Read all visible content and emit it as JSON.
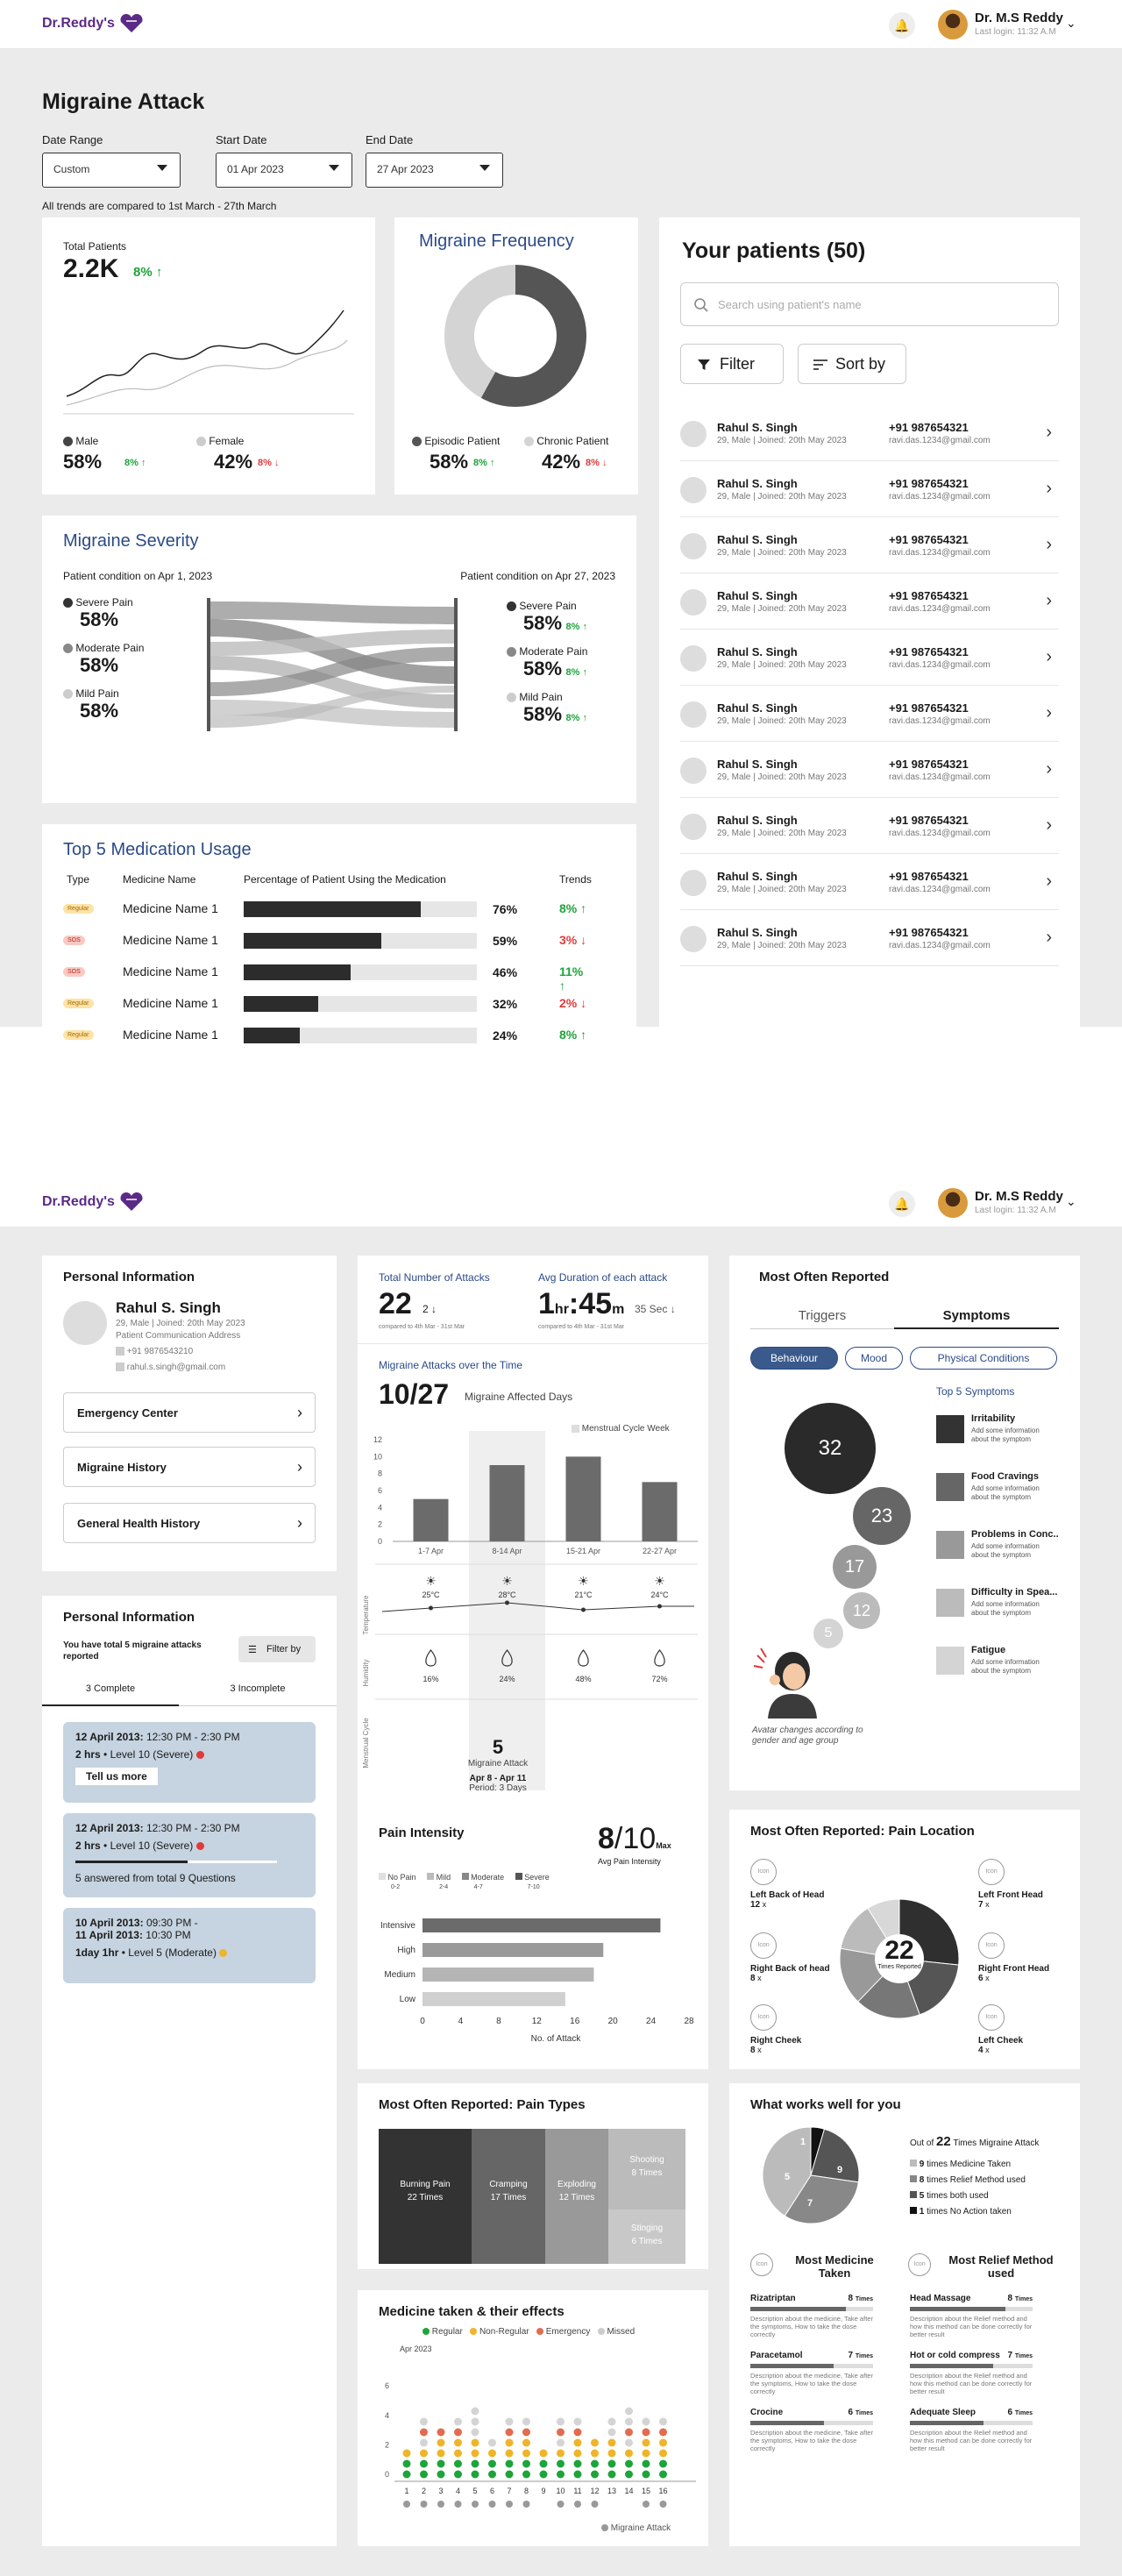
{
  "brand": {
    "name": "Dr.Reddy's"
  },
  "user": {
    "name": "Dr. M.S Reddy",
    "last_login": "Last login: 11:32 A.M"
  },
  "page": {
    "title": "Migraine Attack",
    "trend_note": "All trends are compared to 1st March - 27th March"
  },
  "filters": {
    "date_range_label": "Date Range",
    "date_range_value": "Custom",
    "start_label": "Start Date",
    "start_value": "01 Apr 2023",
    "end_label": "End Date",
    "end_value": "27 Apr 2023"
  },
  "total_patients": {
    "label": "Total Patients",
    "value": "2.2K",
    "trend": "8%",
    "male_label": "Male",
    "male_value": "58%",
    "male_trend": "8%",
    "female_label": "Female",
    "female_value": "42%",
    "female_trend": "8%"
  },
  "frequency": {
    "title": "Migraine Frequency",
    "episodic_label": "Episodic Patient",
    "episodic_value": "58%",
    "episodic_trend": "8%",
    "chronic_label": "Chronic Patient",
    "chronic_value": "42%",
    "chronic_trend": "8%"
  },
  "severity": {
    "title": "Migraine Severity",
    "left_caption": "Patient condition on Apr 1, 2023",
    "right_caption": "Patient condition on Apr 27, 2023",
    "left": [
      {
        "label": "Severe Pain",
        "value": "58%"
      },
      {
        "label": "Moderate Pain",
        "value": "58%"
      },
      {
        "label": "Mild Pain",
        "value": "58%"
      }
    ],
    "right": [
      {
        "label": "Severe Pain",
        "value": "58%",
        "trend": "8%"
      },
      {
        "label": "Moderate Pain",
        "value": "58%",
        "trend": "8%"
      },
      {
        "label": "Mild Pain",
        "value": "58%",
        "trend": "8%"
      }
    ]
  },
  "medication": {
    "title": "Top 5 Medication Usage",
    "col_type": "Type",
    "col_name": "Medicine Name",
    "col_pct": "Percentage of Patient Using the Medication",
    "col_trend": "Trends",
    "rows": [
      {
        "type": "Regular",
        "name": "Medicine Name 1",
        "pct": "76%",
        "pct_value": 76,
        "trend": "8%",
        "dir": "up"
      },
      {
        "type": "SOS",
        "name": "Medicine Name 1",
        "pct": "59%",
        "pct_value": 59,
        "trend": "3%",
        "dir": "down"
      },
      {
        "type": "SOS",
        "name": "Medicine Name 1",
        "pct": "46%",
        "pct_value": 46,
        "trend": "11%",
        "dir": "up"
      },
      {
        "type": "Regular",
        "name": "Medicine Name 1",
        "pct": "32%",
        "pct_value": 32,
        "trend": "2%",
        "dir": "down"
      },
      {
        "type": "Regular",
        "name": "Medicine Name 1",
        "pct": "24%",
        "pct_value": 24,
        "trend": "8%",
        "dir": "up"
      }
    ]
  },
  "patients": {
    "title": "Your patients (50)",
    "search_placeholder": "Search using patient's name",
    "filter_label": "Filter",
    "sort_label": "Sort by",
    "items": [
      {
        "name": "Rahul S. Singh",
        "meta": "29, Male | Joined: 20th May 2023",
        "phone": "+91 987654321",
        "email": "ravi.das.1234@gmail.com"
      },
      {
        "name": "Rahul S. Singh",
        "meta": "29, Male | Joined: 20th May 2023",
        "phone": "+91 987654321",
        "email": "ravi.das.1234@gmail.com"
      },
      {
        "name": "Rahul S. Singh",
        "meta": "29, Male | Joined: 20th May 2023",
        "phone": "+91 987654321",
        "email": "ravi.das.1234@gmail.com"
      },
      {
        "name": "Rahul S. Singh",
        "meta": "29, Male | Joined: 20th May 2023",
        "phone": "+91 987654321",
        "email": "ravi.das.1234@gmail.com"
      },
      {
        "name": "Rahul S. Singh",
        "meta": "29, Male | Joined: 20th May 2023",
        "phone": "+91 987654321",
        "email": "ravi.das.1234@gmail.com"
      },
      {
        "name": "Rahul S. Singh",
        "meta": "29, Male | Joined: 20th May 2023",
        "phone": "+91 987654321",
        "email": "ravi.das.1234@gmail.com"
      },
      {
        "name": "Rahul S. Singh",
        "meta": "29, Male | Joined: 20th May 2023",
        "phone": "+91 987654321",
        "email": "ravi.das.1234@gmail.com"
      },
      {
        "name": "Rahul S. Singh",
        "meta": "29, Male | Joined: 20th May 2023",
        "phone": "+91 987654321",
        "email": "ravi.das.1234@gmail.com"
      },
      {
        "name": "Rahul S. Singh",
        "meta": "29, Male | Joined: 20th May 2023",
        "phone": "+91 987654321",
        "email": "ravi.das.1234@gmail.com"
      },
      {
        "name": "Rahul S. Singh",
        "meta": "29, Male | Joined: 20th May 2023",
        "phone": "+91 987654321",
        "email": "ravi.das.1234@gmail.com"
      }
    ]
  },
  "personal": {
    "title": "Personal Information",
    "name": "Rahul S. Singh",
    "meta": "29, Male | Joined: 20th May 2023",
    "address": "Patient Communication Address",
    "phone": "+91 9876543210",
    "email": "rahul.s.singh@gmail.com",
    "links": [
      "Emergency Center",
      "Migraine History",
      "General Health History"
    ]
  },
  "attacks": {
    "title": "Personal Information",
    "summary": "You have total 5 migraine attacks reported",
    "filter_label": "Filter by",
    "tab_complete": "3 Complete",
    "tab_incomplete": "3 Incomplete",
    "items": [
      {
        "date": "12 April 2013:",
        "time": "12:30 PM - 2:30 PM",
        "dur": "2 hrs",
        "level": "Level 10 (Severe)",
        "action": "Tell us more"
      },
      {
        "date": "12 April 2013:",
        "time": "12:30 PM - 2:30 PM",
        "dur": "2 hrs",
        "level": "Level 10 (Severe)",
        "note": "5 answered from total 9 Questions"
      },
      {
        "date": "10 April 2013:",
        "time": "09:30 PM -",
        "date2": "11 April 2013:",
        "time2": "10:30 PM",
        "dur": "1day 1hr",
        "level": "Level 5 (Moderate)"
      }
    ]
  },
  "stats": {
    "total_label": "Total Number of Attacks",
    "total_value": "22",
    "total_delta": "2",
    "total_compare": "compared to 4th Mar - 31st Mar",
    "avg_label": "Avg Duration of each attack",
    "avg_h": "1",
    "avg_hu": "hr",
    "avg_m": "45",
    "avg_mu": "m",
    "avg_delta": "35 Sec",
    "avg_compare": "compared to 4th Mar - 31st Mar"
  },
  "attacks_time": {
    "title": "Migraine Attacks over the Time",
    "days": "10/27",
    "days_label": "Migraine Affected Days",
    "legend": "Menstrual Cycle Week",
    "temp_label": "Temperature",
    "hum_label": "Humidity",
    "cycle_label": "Menstrual Cycle",
    "cycle_count": "5",
    "cycle_text": "Migraine Attack",
    "cycle_dates": "Apr 8 - Apr 11",
    "cycle_period": "Period: 3 Days"
  },
  "pain_intensity": {
    "title": "Pain Intensity",
    "value": "8",
    "max": "/10",
    "max_label": "Max",
    "sub": "Avg Pain Intensity",
    "legend": [
      "No Pain",
      "Mild",
      "Moderate",
      "Severe"
    ],
    "legend_range": [
      "0-2",
      "2-4",
      "4-7",
      "7-10"
    ],
    "xlabel": "No. of Attack"
  },
  "pain_types": {
    "title": "Most Often Reported: Pain Types",
    "items": [
      {
        "name": "Burning Pain",
        "times": "22 Times"
      },
      {
        "name": "Cramping",
        "times": "17 Times"
      },
      {
        "name": "Exploding",
        "times": "12 Times"
      },
      {
        "name": "Shooting",
        "times": "8 Times"
      },
      {
        "name": "Stinging",
        "times": "6 Times"
      }
    ]
  },
  "med_effects": {
    "title": "Medicine taken & their effects",
    "legend": [
      "Regular",
      "Non-Regular",
      "Emergency",
      "Missed"
    ],
    "month": "Apr 2023",
    "footer": "Migraine Attack"
  },
  "reported": {
    "title": "Most Often Reported",
    "tab_triggers": "Triggers",
    "tab_symptoms": "Symptoms",
    "pills": [
      "Behaviour",
      "Mood",
      "Physical Conditions"
    ],
    "top5": "Top 5 Symptoms",
    "caption": "Avatar changes according to gender and age group",
    "bubbles": [
      "32",
      "23",
      "17",
      "12",
      "5"
    ],
    "symptoms": [
      {
        "name": "Irritability",
        "desc": "Add some information about the symptom"
      },
      {
        "name": "Food Cravings",
        "desc": "Add some information about the symptom"
      },
      {
        "name": "Problems in Conc...",
        "desc": "Add some information about the symptom"
      },
      {
        "name": "Difficulty in Spea...",
        "desc": "Add some information about the symptom"
      },
      {
        "name": "Fatigue",
        "desc": "Add some information about the symptom"
      }
    ]
  },
  "location": {
    "title": "Most Often Reported: Pain Location",
    "center_value": "22",
    "center_label": "Times Reported",
    "icon_text": "Icon",
    "items": [
      {
        "name": "Left Back of Head",
        "count": "12",
        "unit": "x"
      },
      {
        "name": "Right Back of head",
        "count": "8",
        "unit": "x"
      },
      {
        "name": "Right Cheek",
        "count": "8",
        "unit": "x"
      },
      {
        "name": "Left Front Head",
        "count": "7",
        "unit": "x"
      },
      {
        "name": "Right Front Head",
        "count": "6",
        "unit": "x"
      },
      {
        "name": "Left Cheek",
        "count": "4",
        "unit": "x"
      }
    ]
  },
  "works": {
    "title": "What works well for you",
    "out_of": "Out of",
    "times": "22",
    "times_label": "Times Migraine Attack",
    "legend": [
      {
        "n": "9",
        "t": "times Medicine Taken"
      },
      {
        "n": "8",
        "t": "times Relief Method used"
      },
      {
        "n": "5",
        "t": "times both used"
      },
      {
        "n": "1",
        "t": "times No Action taken"
      }
    ],
    "pie_labels": [
      "1",
      "5",
      "7",
      "9"
    ],
    "med_title": "Most Medicine Taken",
    "relief_title": "Most Relief Method used",
    "icon_text": "Icon",
    "meds": [
      {
        "name": "Rizatriptan",
        "n": "8",
        "u": "Times",
        "desc": "Description about the medicine, Take after the symptoms, How to take the dose correctly"
      },
      {
        "name": "Paracetamol",
        "n": "7",
        "u": "Times",
        "desc": "Description about the medicine, Take after the symptoms, How to take the dose correctly"
      },
      {
        "name": "Crocine",
        "n": "6",
        "u": "Times",
        "desc": "Description about the medicine, Take after the symptoms, How to take the dose correctly"
      }
    ],
    "reliefs": [
      {
        "name": "Head Massage",
        "n": "8",
        "u": "Times",
        "desc": "Description about the Relief method and how this method can be done correctly for better result"
      },
      {
        "name": "Hot or cold compress",
        "n": "7",
        "u": "Times",
        "desc": "Description about the Relief method and how this method can be done correctly for better result"
      },
      {
        "name": "Adequate Sleep",
        "n": "6",
        "u": "Times",
        "desc": "Description about the Relief method and how this method can be done correctly for better result"
      }
    ]
  },
  "chart_data": [
    {
      "type": "bar",
      "title": "Migraine Attacks over the Time",
      "categories": [
        "1-7 Apr",
        "8-14 Apr",
        "15-21 Apr",
        "22-27 Apr"
      ],
      "values": [
        5,
        9,
        10,
        7
      ],
      "ylim": [
        0,
        12
      ],
      "yticks": [
        "0",
        "2",
        "4",
        "6",
        "8",
        "10",
        "12"
      ],
      "temperature": [
        "25°C",
        "28°C",
        "21°C",
        "24°C"
      ],
      "humidity": [
        "16%",
        "24%",
        "48%",
        "72%"
      ]
    },
    {
      "type": "bar",
      "title": "Pain Intensity",
      "categories": [
        "Intensive",
        "High",
        "Medium",
        "Low"
      ],
      "values": [
        25,
        19,
        18,
        15
      ],
      "xlim": [
        0,
        28
      ],
      "xticks": [
        "0",
        "4",
        "8",
        "12",
        "16",
        "20",
        "24",
        "28"
      ],
      "xlabel": "No. of Attack"
    },
    {
      "type": "pie",
      "title": "Migraine Frequency",
      "labels": [
        "Episodic Patient",
        "Chronic Patient"
      ],
      "values": [
        58,
        42
      ]
    },
    {
      "type": "scatter",
      "title": "Medicine taken & their effects",
      "x": [
        "1",
        "2",
        "3",
        "4",
        "5",
        "6",
        "7",
        "8",
        "9",
        "10",
        "11",
        "12",
        "13",
        "14",
        "15",
        "16"
      ],
      "yticks": [
        "0",
        "2",
        "4",
        "6"
      ]
    }
  ]
}
